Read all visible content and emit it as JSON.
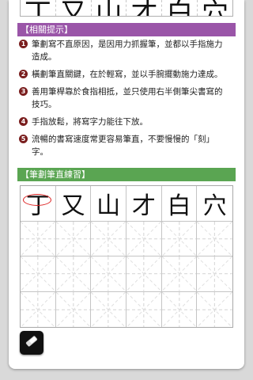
{
  "top_strip": {
    "characters": [
      "丁",
      "又",
      "山",
      "才",
      "白",
      "穴"
    ]
  },
  "hints": {
    "title": "【相關提示】",
    "items": [
      {
        "num": "1",
        "text": "筆劃寫不直原因，是因用力抓握筆，並都以手指施力造成。"
      },
      {
        "num": "2",
        "text": "橫劃筆直關鍵，在於輕寫，並以手腕擺動施力達成。"
      },
      {
        "num": "3",
        "text": "善用筆桿靠於食指相抵，並只使用右半側筆尖書寫的技巧。"
      },
      {
        "num": "4",
        "text": "手指放鬆，將寫字力能往下放。"
      },
      {
        "num": "5",
        "text": "流暢的書寫速度常更容易筆直，不要慢慢的「刻」字。"
      }
    ]
  },
  "practice": {
    "title": "【筆劃筆直練習】",
    "characters": [
      "丁",
      "又",
      "山",
      "才",
      "白",
      "穴"
    ],
    "blank_rows": 3
  },
  "toolbar": {
    "eraser_icon": "eraser-icon"
  },
  "colors": {
    "hints_header": "#9a55a8",
    "practice_header": "#5aa552",
    "tip_number": "#7a1e1e",
    "highlight_ring": "#dd2222"
  }
}
